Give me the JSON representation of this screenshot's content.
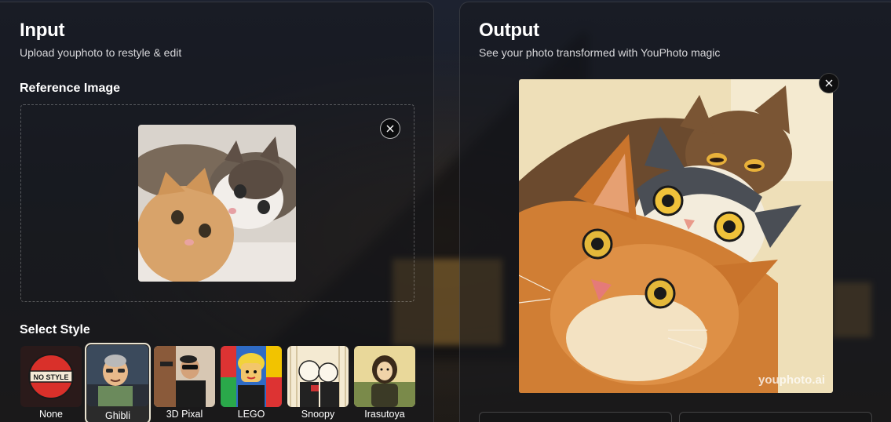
{
  "input_panel": {
    "title": "Input",
    "subtitle": "Upload youphoto to restyle & edit",
    "reference_label": "Reference Image",
    "style_label": "Select Style"
  },
  "styles": [
    {
      "label": "None",
      "badge": "NO STYLE",
      "selected": false
    },
    {
      "label": "Ghibli",
      "selected": true
    },
    {
      "label": "3D Pixal",
      "selected": false
    },
    {
      "label": "LEGO",
      "selected": false
    },
    {
      "label": "Snoopy",
      "selected": false
    },
    {
      "label": "Irasutoya",
      "selected": false
    }
  ],
  "output_panel": {
    "title": "Output",
    "subtitle": "See your photo transformed with YouPhoto magic",
    "watermark": "youphoto.ai"
  },
  "icons": {
    "close": "close-icon"
  },
  "colors": {
    "accent_selected_border": "#e8e2d0",
    "no_style_red": "#d9302a",
    "background": "#1c1f27"
  }
}
